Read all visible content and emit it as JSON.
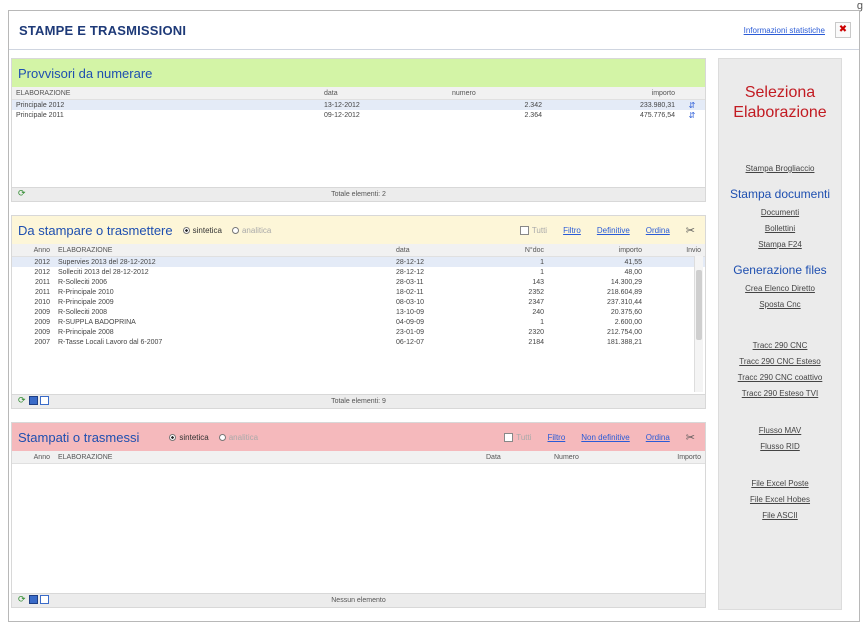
{
  "corner_text": "g",
  "header": {
    "title": "STAMPE E TRASMISSIONI",
    "info_link": "Informazioni statistiche",
    "close_glyph": "✖"
  },
  "panel1": {
    "title": "Provvisori da numerare",
    "columns": [
      "ELABORAZIONE",
      "data",
      "numero",
      "importo"
    ],
    "rows": [
      {
        "elaborazione": "Principale 2012",
        "data": "13-12-2012",
        "numero": "2.342",
        "importo": "233.980,31"
      },
      {
        "elaborazione": "Principale 2011",
        "data": "09-12-2012",
        "numero": "2.364",
        "importo": "475.776,54"
      }
    ],
    "row_icon": "⇵",
    "footer": "Totale elementi: 2"
  },
  "panel2": {
    "title": "Da stampare o trasmettere",
    "radio_sintetica": "sintetica",
    "radio_analitica": "analitica",
    "check_tutti": "Tutti",
    "link_filtro": "Filtro",
    "link_definitive": "Definitive",
    "link_ordina": "Ordina",
    "tool_icon": "✂",
    "columns": [
      "Anno",
      "ELABORAZIONE",
      "data",
      "N°doc",
      "importo",
      "Invio"
    ],
    "rows": [
      {
        "anno": "2012",
        "elaborazione": "Supervies 2013 del 28-12-2012",
        "data": "28-12-12",
        "ndoc": "1",
        "importo": "41,55"
      },
      {
        "anno": "2012",
        "elaborazione": "Solleciti 2013 del 28-12-2012",
        "data": "28-12-12",
        "ndoc": "1",
        "importo": "48,00"
      },
      {
        "anno": "2011",
        "elaborazione": "R-Solleciti 2006",
        "data": "28-03-11",
        "ndoc": "143",
        "importo": "14.300,29"
      },
      {
        "anno": "2011",
        "elaborazione": "R-Principale 2010",
        "data": "18-02-11",
        "ndoc": "2352",
        "importo": "218.604,89"
      },
      {
        "anno": "2010",
        "elaborazione": "R-Principale 2009",
        "data": "08-03-10",
        "ndoc": "2347",
        "importo": "237.310,44"
      },
      {
        "anno": "2009",
        "elaborazione": "R-Solleciti 2008",
        "data": "13-10-09",
        "ndoc": "240",
        "importo": "20.375,60"
      },
      {
        "anno": "2009",
        "elaborazione": "R-SUPPLA BADOPRINA",
        "data": "04-09-09",
        "ndoc": "1",
        "importo": "2.600,00"
      },
      {
        "anno": "2009",
        "elaborazione": "R-Principale 2008",
        "data": "23-01-09",
        "ndoc": "2320",
        "importo": "212.754,00"
      },
      {
        "anno": "2007",
        "elaborazione": "R-Tasse Locali Lavoro dal 6-2007",
        "data": "06-12-07",
        "ndoc": "2184",
        "importo": "181.388,21"
      }
    ],
    "footer": "Totale elementi: 9"
  },
  "panel3": {
    "title": "Stampati o trasmessi",
    "radio_sintetica": "sintetica",
    "radio_analitica": "analitica",
    "check_tutti": "Tutti",
    "link_filtro": "Filtro",
    "link_non_definitive": "Non definitive",
    "link_ordina": "Ordina",
    "tool_icon": "✂",
    "columns": [
      "Anno",
      "ELABORAZIONE",
      "Data",
      "Numero",
      "Importo"
    ],
    "footer": "Nessun elemento"
  },
  "footer_icons": {
    "refresh": "⟳"
  },
  "sidebar": {
    "title_line1": "Seleziona",
    "title_line2": "Elaborazione",
    "link_stampa_brogliaccio": "Stampa Brogliaccio",
    "group_stampa": "Stampa documenti",
    "link_documenti": "Documenti",
    "link_bollettini": "Bollettini",
    "link_stampa_f24": "Stampa F24",
    "group_generazione": "Generazione files",
    "link_crea_elenco": "Crea Elenco Diretto",
    "link_sposta_cnc": "Sposta Cnc",
    "link_tracc_cnc": "Tracc 290 CNC",
    "link_tracc_esteso": "Tracc 290 CNC Esteso",
    "link_tracc_coattivo": "Tracc 290 CNC coattivo",
    "link_tracc_tvi": "Tracc 290 Esteso TVI",
    "link_flusso_mav": "Flusso MAV",
    "link_flusso_rid": "Flusso RID",
    "link_excel_poste": "File Excel Poste",
    "link_excel_hobes": "File Excel Hobes",
    "link_ascii": "File ASCII"
  }
}
